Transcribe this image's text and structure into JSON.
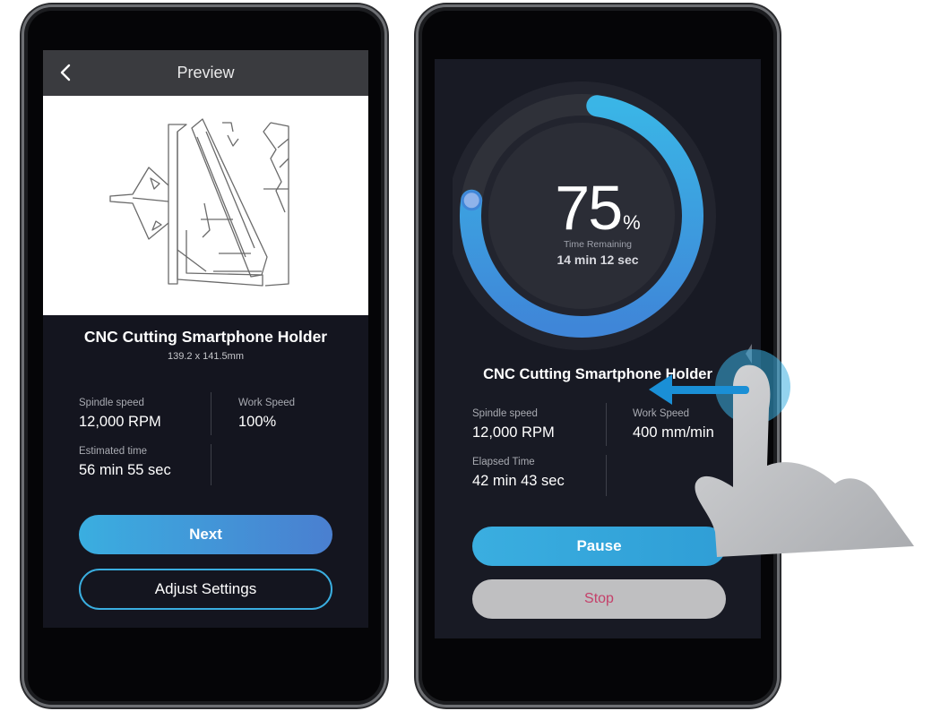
{
  "preview_screen": {
    "title": "Preview",
    "job_name": "CNC Cutting Smartphone Holder",
    "dimensions": "139.2 x 141.5mm",
    "stats": [
      {
        "label": "Spindle speed",
        "value": "12,000 RPM"
      },
      {
        "label": "Work Speed",
        "value": "100%"
      },
      {
        "label": "Estimated time",
        "value": "56 min 55 sec"
      }
    ],
    "next_label": "Next",
    "adjust_label": "Adjust Settings"
  },
  "progress_screen": {
    "percent": "75",
    "percent_sign": "%",
    "progress_fraction": 0.75,
    "time_remaining_label": "Time Remaining",
    "time_remaining_value": "14 min 12 sec",
    "job_name": "CNC Cutting Smartphone Holder",
    "stats": [
      {
        "label": "Spindle speed",
        "value": "12,000 RPM"
      },
      {
        "label": "Work Speed",
        "value": "400 mm/min"
      },
      {
        "label": "Elapsed Time",
        "value": "42 min 43 sec"
      }
    ],
    "pause_label": "Pause",
    "stop_label": "Stop"
  },
  "colors": {
    "accent": "#3aaee0",
    "stop_text": "#c4406a",
    "screen_bg": "#14151f"
  },
  "icons": [
    "chevron-left-icon",
    "swipe-left-arrow-icon",
    "hand-gesture-icon"
  ]
}
